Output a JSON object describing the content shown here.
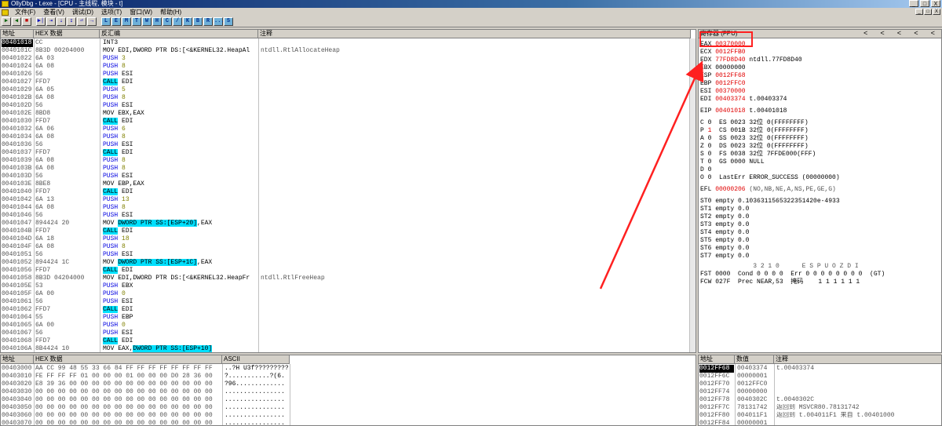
{
  "window": {
    "title": "OllyDbg - t.exe - [CPU - 主线程, 模块 - t]",
    "buttons": [
      "_",
      "□",
      "X"
    ]
  },
  "menu": [
    "文件(F)",
    "查看(V)",
    "调试(D)",
    "选项(T)",
    "窗口(W)",
    "帮助(H)"
  ],
  "toolbar": {
    "buttons": [
      "▶",
      "◀",
      "■",
      "▶|",
      "⇥",
      "⇣",
      "↧",
      "⏎",
      "→",
      "⋯"
    ],
    "letters": [
      "L",
      "E",
      "M",
      "T",
      "W",
      "H",
      "C",
      "/",
      "K",
      "B",
      "R",
      "...",
      "S"
    ]
  },
  "disasm": {
    "headers": {
      "addr": "地址",
      "hex": "HEX 数据",
      "asm": "反汇编",
      "comment": "注释"
    },
    "rows": [
      {
        "addr": "00401018",
        "hex": "CC",
        "asm": "INT3",
        "comment": "",
        "selected": true
      },
      {
        "addr": "0040101C",
        "hex": "8B3D 00204000",
        "asm": "MOV EDI,DWORD PTR DS:[<&KERNEL32.HeapAl",
        "comment": "ntdll.RtlAllocateHeap"
      },
      {
        "addr": "00401022",
        "hex": "6A 03",
        "op": "PUSH",
        "arg": "3",
        "comment": ""
      },
      {
        "addr": "00401024",
        "hex": "6A 08",
        "op": "PUSH",
        "arg": "8",
        "comment": ""
      },
      {
        "addr": "00401026",
        "hex": "56",
        "op": "PUSH",
        "arg": "ESI",
        "comment": ""
      },
      {
        "addr": "00401027",
        "hex": "FFD7",
        "op": "CALL",
        "arg": "EDI",
        "comment": ""
      },
      {
        "addr": "00401029",
        "hex": "6A 05",
        "op": "PUSH",
        "arg": "5",
        "comment": ""
      },
      {
        "addr": "0040102B",
        "hex": "6A 08",
        "op": "PUSH",
        "arg": "8",
        "comment": ""
      },
      {
        "addr": "0040102D",
        "hex": "56",
        "op": "PUSH",
        "arg": "ESI",
        "comment": ""
      },
      {
        "addr": "0040102E",
        "hex": "8BD8",
        "asm": "MOV EBX,EAX",
        "comment": ""
      },
      {
        "addr": "00401030",
        "hex": "FFD7",
        "op": "CALL",
        "arg": "EDI",
        "comment": ""
      },
      {
        "addr": "00401032",
        "hex": "6A 06",
        "op": "PUSH",
        "arg": "6",
        "comment": ""
      },
      {
        "addr": "00401034",
        "hex": "6A 08",
        "op": "PUSH",
        "arg": "8",
        "comment": ""
      },
      {
        "addr": "00401036",
        "hex": "56",
        "op": "PUSH",
        "arg": "ESI",
        "comment": ""
      },
      {
        "addr": "00401037",
        "hex": "FFD7",
        "op": "CALL",
        "arg": "EDI",
        "comment": ""
      },
      {
        "addr": "00401039",
        "hex": "6A 08",
        "op": "PUSH",
        "arg": "8",
        "comment": ""
      },
      {
        "addr": "0040103B",
        "hex": "6A 08",
        "op": "PUSH",
        "arg": "8",
        "comment": ""
      },
      {
        "addr": "0040103D",
        "hex": "56",
        "op": "PUSH",
        "arg": "ESI",
        "comment": ""
      },
      {
        "addr": "0040103E",
        "hex": "8BE8",
        "asm": "MOV EBP,EAX",
        "comment": ""
      },
      {
        "addr": "00401040",
        "hex": "FFD7",
        "op": "CALL",
        "arg": "EDI",
        "comment": ""
      },
      {
        "addr": "00401042",
        "hex": "6A 13",
        "op": "PUSH",
        "arg": "13",
        "comment": ""
      },
      {
        "addr": "00401044",
        "hex": "6A 08",
        "op": "PUSH",
        "arg": "8",
        "comment": ""
      },
      {
        "addr": "00401046",
        "hex": "56",
        "op": "PUSH",
        "arg": "ESI",
        "comment": ""
      },
      {
        "addr": "00401047",
        "hex": "894424 20",
        "pre": "MOV ",
        "hlpart": "DWORD PTR SS:[ESP+20]",
        "post": ",EAX",
        "comment": ""
      },
      {
        "addr": "0040104B",
        "hex": "FFD7",
        "op": "CALL",
        "arg": "EDI",
        "comment": ""
      },
      {
        "addr": "0040104D",
        "hex": "6A 18",
        "op": "PUSH",
        "arg": "18",
        "comment": ""
      },
      {
        "addr": "0040104F",
        "hex": "6A 08",
        "op": "PUSH",
        "arg": "8",
        "comment": ""
      },
      {
        "addr": "00401051",
        "hex": "56",
        "op": "PUSH",
        "arg": "ESI",
        "comment": ""
      },
      {
        "addr": "00401052",
        "hex": "894424 1C",
        "pre": "MOV ",
        "hlpart": "DWORD PTR SS:[ESP+1C]",
        "post": ",EAX",
        "comment": ""
      },
      {
        "addr": "00401056",
        "hex": "FFD7",
        "op": "CALL",
        "arg": "EDI",
        "comment": ""
      },
      {
        "addr": "00401058",
        "hex": "8B3D 04204000",
        "asm": "MOV EDI,DWORD PTR DS:[<&KERNEL32.HeapFr",
        "comment": "ntdll.RtlFreeHeap"
      },
      {
        "addr": "0040105E",
        "hex": "53",
        "op": "PUSH",
        "arg": "EBX",
        "comment": ""
      },
      {
        "addr": "0040105F",
        "hex": "6A 00",
        "op": "PUSH",
        "arg": "0",
        "comment": ""
      },
      {
        "addr": "00401061",
        "hex": "56",
        "op": "PUSH",
        "arg": "ESI",
        "comment": ""
      },
      {
        "addr": "00401062",
        "hex": "FFD7",
        "op": "CALL",
        "arg": "EDI",
        "comment": ""
      },
      {
        "addr": "00401064",
        "hex": "55",
        "op": "PUSH",
        "arg": "EBP",
        "comment": ""
      },
      {
        "addr": "00401065",
        "hex": "6A 00",
        "op": "PUSH",
        "arg": "0",
        "comment": ""
      },
      {
        "addr": "00401067",
        "hex": "56",
        "op": "PUSH",
        "arg": "ESI",
        "comment": ""
      },
      {
        "addr": "00401068",
        "hex": "FFD7",
        "op": "CALL",
        "arg": "EDI",
        "comment": ""
      },
      {
        "addr": "0040106A",
        "hex": "8B4424 10",
        "pre": "MOV EAX,",
        "hlpart": "DWORD PTR SS:[ESP+10]",
        "post": "",
        "comment": ""
      }
    ]
  },
  "registers": {
    "title": "寄存器 (FPU)",
    "nav": [
      "<",
      "<",
      "<",
      "<",
      "<"
    ],
    "gp": [
      {
        "name": "EAX",
        "value": "00370000",
        "red": true,
        "note": ""
      },
      {
        "name": "ECX",
        "value": "0012FFB0",
        "red": true,
        "note": ""
      },
      {
        "name": "EDX",
        "value": "77FD8D40",
        "red": true,
        "note": "ntdll.77FD8D40"
      },
      {
        "name": "EBX",
        "value": "00000000",
        "red": false,
        "note": ""
      },
      {
        "name": "ESP",
        "value": "0012FF68",
        "red": true,
        "note": ""
      },
      {
        "name": "EBP",
        "value": "0012FFC0",
        "red": true,
        "note": ""
      },
      {
        "name": "ESI",
        "value": "00370000",
        "red": true,
        "note": ""
      },
      {
        "name": "EDI",
        "value": "00403374",
        "red": true,
        "note": "t.00403374"
      }
    ],
    "eip": {
      "name": "EIP",
      "value": "00401018",
      "note": "t.00401018"
    },
    "segs": [
      {
        "flag": "C 0",
        "seg": "ES 0023 32位 0(FFFFFFFF)"
      },
      {
        "flag": "P 1",
        "seg": "CS 001B 32位 0(FFFFFFFF)"
      },
      {
        "flag": "A 0",
        "seg": "SS 0023 32位 0(FFFFFFFF)"
      },
      {
        "flag": "Z 0",
        "seg": "DS 0023 32位 0(FFFFFFFF)"
      },
      {
        "flag": "S 0",
        "seg": "FS 0038 32位 7FFDE000(FFF)"
      },
      {
        "flag": "T 0",
        "seg": "GS 0000 NULL"
      },
      {
        "flag": "D 0",
        "seg": ""
      },
      {
        "flag": "O 0",
        "seg": "LastErr ERROR_SUCCESS (00000000)"
      }
    ],
    "efl": {
      "name": "EFL",
      "value": "00000206",
      "note": "(NO,NB,NE,A,NS,PE,GE,G)"
    },
    "fpu": [
      "ST0 empty 0.1036311565322351420e-4933",
      "ST1 empty 0.0",
      "ST2 empty 0.0",
      "ST3 empty 0.0",
      "ST4 empty 0.0",
      "ST5 empty 0.0",
      "ST6 empty 0.0",
      "ST7 empty 0.0"
    ],
    "fpu_hdr": "3 2 1 0      E S P U O Z D I",
    "fst": "FST 0000  Cond 0 0 0 0  Err 0 0 0 0 0 0 0 0  (GT)",
    "fcw": "FCW 027F  Prec NEAR,53  掩码    1 1 1 1 1 1"
  },
  "dump": {
    "headers": {
      "addr": "地址",
      "hex": "HEX 数据",
      "ascii": "ASCII"
    },
    "rows": [
      {
        "addr": "00403000",
        "hex": "AA CC 99 48 55 33 66 84 FF FF FF FF FF FF FF FF",
        "ascii": "..?H U3f?????????"
      },
      {
        "addr": "00403010",
        "hex": "FE FF FF FF 01 00 00 00 01 00 00 00 D0 28 36 00",
        "ascii": "?...........?(6."
      },
      {
        "addr": "00403020",
        "hex": "E8 39 36 00 00 00 00 00 00 00 00 00 00 00 00 00",
        "ascii": "?96............."
      },
      {
        "addr": "00403030",
        "hex": "00 00 00 00 00 00 00 00 00 00 00 00 00 00 00 00",
        "ascii": "................"
      },
      {
        "addr": "00403040",
        "hex": "00 00 00 00 00 00 00 00 00 00 00 00 00 00 00 00",
        "ascii": "................"
      },
      {
        "addr": "00403050",
        "hex": "00 00 00 00 00 00 00 00 00 00 00 00 00 00 00 00",
        "ascii": "................"
      },
      {
        "addr": "00403060",
        "hex": "00 00 00 00 00 00 00 00 00 00 00 00 00 00 00 00",
        "ascii": "................"
      },
      {
        "addr": "00403070",
        "hex": "00 00 00 00 00 00 00 00 00 00 00 00 00 00 00 00",
        "ascii": "................"
      }
    ]
  },
  "stack": {
    "headers": {
      "addr": "地址",
      "value": "数值",
      "comment": "注释"
    },
    "rows": [
      {
        "addr": "0012FF68",
        "value": "00403374",
        "comment": "t.00403374",
        "selected": true
      },
      {
        "addr": "0012FF6C",
        "value": "00000001",
        "comment": ""
      },
      {
        "addr": "0012FF70",
        "value": "0012FFC0",
        "comment": ""
      },
      {
        "addr": "0012FF74",
        "value": "00000000",
        "comment": ""
      },
      {
        "addr": "0012FF78",
        "value": "0040302C",
        "comment": "t.0040302C"
      },
      {
        "addr": "0012FF7C",
        "value": "78131742",
        "comment": "返回到 MSVCR80.78131742"
      },
      {
        "addr": "0012FF80",
        "value": "004011F1",
        "comment": "返回到 t.004011F1 来自 t.00401000"
      },
      {
        "addr": "0012FF84",
        "value": "00000001",
        "comment": ""
      }
    ]
  },
  "colors": {
    "highlight": "#00e0ff",
    "register_changed": "#e00000",
    "annotation": "#ff2020"
  }
}
